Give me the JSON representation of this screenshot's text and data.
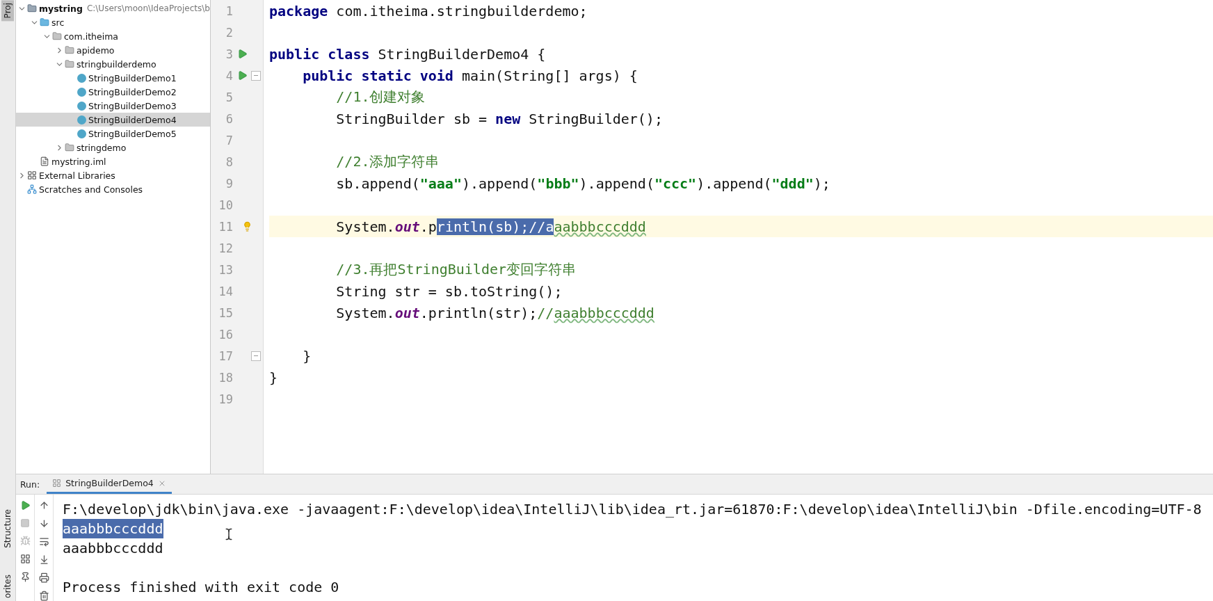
{
  "left_strip": {
    "top_tab": "Proj",
    "bottom_tabs": [
      "Structure",
      "orites"
    ]
  },
  "project_tree": {
    "items": [
      {
        "kind": "module",
        "label": "mystring",
        "detail": "C:\\Users\\moon\\IdeaProjects\\b",
        "expanded": true,
        "selected": false,
        "children": [
          {
            "kind": "source",
            "label": "src",
            "expanded": true,
            "selected": false,
            "children": [
              {
                "kind": "package",
                "label": "com.itheima",
                "expanded": true,
                "selected": false,
                "children": [
                  {
                    "kind": "package",
                    "label": "apidemo",
                    "expanded": false,
                    "selected": false
                  },
                  {
                    "kind": "package",
                    "label": "stringbuilderdemo",
                    "expanded": true,
                    "selected": false,
                    "children": [
                      {
                        "kind": "class",
                        "label": "StringBuilderDemo1",
                        "selected": false
                      },
                      {
                        "kind": "class",
                        "label": "StringBuilderDemo2",
                        "selected": false
                      },
                      {
                        "kind": "class",
                        "label": "StringBuilderDemo3",
                        "selected": false
                      },
                      {
                        "kind": "class",
                        "label": "StringBuilderDemo4",
                        "selected": true
                      },
                      {
                        "kind": "class",
                        "label": "StringBuilderDemo5",
                        "selected": false
                      }
                    ]
                  },
                  {
                    "kind": "package",
                    "label": "stringdemo",
                    "expanded": false,
                    "selected": false
                  }
                ]
              }
            ]
          },
          {
            "kind": "iml",
            "label": "mystring.iml",
            "selected": false
          }
        ]
      },
      {
        "kind": "libraries",
        "label": "External Libraries",
        "expanded": false,
        "selected": false
      },
      {
        "kind": "scratches",
        "label": "Scratches and Consoles",
        "selected": false
      }
    ]
  },
  "editor": {
    "lines": [
      {
        "number": "1",
        "current": false,
        "fold": false,
        "tokens": [
          {
            "kind": "keyword",
            "text": "package"
          },
          {
            "kind": "plain",
            "text": " com.itheima.stringbuilderdemo;"
          }
        ]
      },
      {
        "number": "2",
        "current": false,
        "fold": false
      },
      {
        "number": "3",
        "current": false,
        "fold": false,
        "gutter": {
          "kind": "run"
        },
        "tokens": [
          {
            "kind": "keyword",
            "text": "public class"
          },
          {
            "kind": "plain",
            "text": " StringBuilderDemo4 {"
          }
        ]
      },
      {
        "number": "4",
        "current": false,
        "fold": true,
        "gutter": {
          "kind": "run"
        },
        "tokens": [
          {
            "kind": "keyword",
            "text": "    public static void"
          },
          {
            "kind": "plain",
            "text": " main(String[] args) {"
          }
        ]
      },
      {
        "number": "5",
        "current": false,
        "fold": false,
        "tokens": [
          {
            "kind": "comment",
            "text": "        //1.创建对象"
          }
        ]
      },
      {
        "number": "6",
        "current": false,
        "fold": false,
        "tokens": [
          {
            "kind": "plain",
            "text": "        StringBuilder sb = "
          },
          {
            "kind": "keyword",
            "text": "new"
          },
          {
            "kind": "plain",
            "text": " StringBuilder();"
          }
        ]
      },
      {
        "number": "7",
        "current": false,
        "fold": false
      },
      {
        "number": "8",
        "current": false,
        "fold": false,
        "tokens": [
          {
            "kind": "comment",
            "text": "        //2.添加字符串"
          }
        ]
      },
      {
        "number": "9",
        "current": false,
        "fold": false,
        "tokens": [
          {
            "kind": "plain",
            "text": "        sb.append("
          },
          {
            "kind": "string",
            "text": "\"aaa\""
          },
          {
            "kind": "plain",
            "text": ").append("
          },
          {
            "kind": "string",
            "text": "\"bbb\""
          },
          {
            "kind": "plain",
            "text": ").append("
          },
          {
            "kind": "string",
            "text": "\"ccc\""
          },
          {
            "kind": "plain",
            "text": ").append("
          },
          {
            "kind": "string",
            "text": "\"ddd\""
          },
          {
            "kind": "plain",
            "text": ");"
          }
        ]
      },
      {
        "number": "10",
        "current": false,
        "fold": false
      },
      {
        "number": "11",
        "current": true,
        "fold": false,
        "gutter": {
          "kind": "bulb"
        },
        "tokens": [
          {
            "kind": "plain",
            "text": "        System."
          },
          {
            "kind": "field",
            "text": "out"
          },
          {
            "kind": "plain",
            "text": ".p"
          },
          {
            "kind": "plain",
            "text": "rintln(sb);",
            "selected": true
          },
          {
            "kind": "comment",
            "text": "//a",
            "selected": true
          },
          {
            "kind": "comment",
            "text": "aabbbcccddd",
            "typo": true
          }
        ]
      },
      {
        "number": "12",
        "current": false,
        "fold": false
      },
      {
        "number": "13",
        "current": false,
        "fold": false,
        "tokens": [
          {
            "kind": "comment",
            "text": "        //3.再把StringBuilder变回字符串"
          }
        ]
      },
      {
        "number": "14",
        "current": false,
        "fold": false,
        "tokens": [
          {
            "kind": "plain",
            "text": "        String str = sb.toString();"
          }
        ]
      },
      {
        "number": "15",
        "current": false,
        "fold": false,
        "tokens": [
          {
            "kind": "plain",
            "text": "        System."
          },
          {
            "kind": "field",
            "text": "out"
          },
          {
            "kind": "plain",
            "text": ".println(str);"
          },
          {
            "kind": "comment",
            "text": "//"
          },
          {
            "kind": "comment",
            "text": "aaabbbcccddd",
            "typo": true
          }
        ]
      },
      {
        "number": "16",
        "current": false,
        "fold": false
      },
      {
        "number": "17",
        "current": false,
        "fold": true,
        "tokens": [
          {
            "kind": "plain",
            "text": "    }"
          }
        ]
      },
      {
        "number": "18",
        "current": false,
        "fold": false,
        "tokens": [
          {
            "kind": "plain",
            "text": "}"
          }
        ]
      },
      {
        "number": "19",
        "current": false,
        "fold": false
      }
    ]
  },
  "run_panel": {
    "label": "Run:",
    "tabs": [
      {
        "label": "StringBuilderDemo4",
        "selected": true
      }
    ],
    "console": [
      {
        "text": "F:\\develop\\jdk\\bin\\java.exe -javaagent:F:\\develop\\idea\\IntelliJ\\lib\\idea_rt.jar=61870:F:\\develop\\idea\\IntelliJ\\bin -Dfile.encoding=UTF-8",
        "selected": false
      },
      {
        "text": "aaabbbcccddd",
        "selected": true
      },
      {
        "text": "aaabbbcccddd",
        "selected": false
      },
      {
        "text": "Process finished with exit code 0",
        "selected": false
      }
    ]
  }
}
